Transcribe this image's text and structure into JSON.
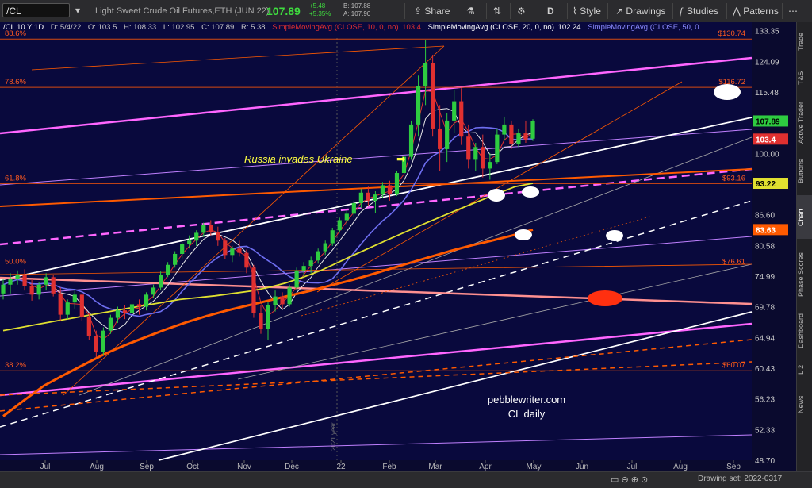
{
  "toolbar": {
    "symbol": "/CL",
    "description": "Light Sweet Crude Oil Futures,ETH (JUN 22)",
    "last": "107.89",
    "change": "+5.48",
    "change_pct": "+5.35%",
    "bid": "B: 107.88",
    "ask": "A: 107.90",
    "share_label": "Share",
    "period_label": "D",
    "style_label": "Style",
    "drawings_label": "Drawings",
    "studies_label": "Studies",
    "patterns_label": "Patterns"
  },
  "legend": {
    "header": "/CL 10 Y 1D",
    "date": "D: 5/4/22",
    "open": "O: 103.5",
    "high": "H: 108.33",
    "low": "L: 102.95",
    "close": "C: 107.89",
    "range": "R: 5.38",
    "sma10": "SimpleMovingAvg (CLOSE, 10, 0, no)",
    "sma10_val": "103.4",
    "sma20": "SimpleMovingAvg (CLOSE, 20, 0, no)",
    "sma20_val": "102.24",
    "sma50": "SimpleMovingAvg (CLOSE, 50, 0..."
  },
  "sidebar": {
    "tabs": [
      "Trade",
      "T&S",
      "Active Trader",
      "Buttons",
      "Chart",
      "Phase Scores",
      "Dashboard",
      "L 2",
      "News"
    ]
  },
  "status": {
    "drawing_set": "Drawing set: 2022-0317"
  },
  "colors": {
    "background": "#09093d",
    "up_candle": "#2ecc40",
    "down_candle": "#e03030",
    "sma10": "#e03030",
    "sma20": "#e8e8e8",
    "sma50": "#6e6ef0",
    "sma100": "#e0e030",
    "sma200": "#ff5a00",
    "magenta": "#ff66ff",
    "fib": "#ff5a00"
  },
  "chart_data": {
    "type": "candlestick",
    "title": "Russia invades Ukraine",
    "watermark": [
      "pebblewriter.com",
      "CL daily"
    ],
    "year_marker": "2021 year",
    "x_categories": [
      "Jul",
      "Aug",
      "Sep",
      "Oct",
      "Nov",
      "Dec",
      "22",
      "Feb",
      "Mar",
      "Apr",
      "May",
      "Jun",
      "Jul",
      "Aug",
      "Sep"
    ],
    "y_ticks": [
      133.35,
      124.09,
      115.48,
      107.89,
      100,
      93.22,
      86.6,
      80.58,
      74.99,
      69.78,
      64.94,
      60.43,
      56.23,
      52.33,
      48.7
    ],
    "y_scale": "log",
    "ylim": [
      48.7,
      136
    ],
    "price_labels": [
      {
        "text": "107.89",
        "value": 107.89,
        "color": "#2ecc40"
      },
      {
        "text": "103.4",
        "value": 103.4,
        "color": "#e03030"
      },
      {
        "text": "93.22",
        "value": 93.22,
        "color": "#e0e030"
      },
      {
        "text": "83.63",
        "value": 83.63,
        "color": "#ff5a00"
      }
    ],
    "fib_levels": [
      {
        "pct": "88.6%",
        "price": "$130.74",
        "value": 130.74
      },
      {
        "pct": "78.6%",
        "price": "$116.72",
        "value": 116.72
      },
      {
        "pct": "61.8%",
        "price": "$93.16",
        "value": 93.16
      },
      {
        "pct": "50.0%",
        "price": "$76.61",
        "value": 76.61
      },
      {
        "pct": "38.2%",
        "price": "$60.07",
        "value": 60.07
      }
    ],
    "candles": [
      {
        "o": 72,
        "h": 74.5,
        "l": 71,
        "c": 73.5
      },
      {
        "o": 73.5,
        "h": 75.5,
        "l": 72,
        "c": 74.5
      },
      {
        "o": 74.5,
        "h": 76,
        "l": 73.5,
        "c": 75.2
      },
      {
        "o": 75.2,
        "h": 76.2,
        "l": 72.5,
        "c": 73.2
      },
      {
        "o": 73.2,
        "h": 74.5,
        "l": 70.8,
        "c": 71.8
      },
      {
        "o": 71.8,
        "h": 74,
        "l": 71,
        "c": 73.5
      },
      {
        "o": 73.5,
        "h": 75.5,
        "l": 72.5,
        "c": 74.8
      },
      {
        "o": 74.8,
        "h": 75.2,
        "l": 71.5,
        "c": 72
      },
      {
        "o": 72,
        "h": 73,
        "l": 67.5,
        "c": 68.5
      },
      {
        "o": 68.5,
        "h": 71,
        "l": 67.8,
        "c": 70.5
      },
      {
        "o": 70.5,
        "h": 72.5,
        "l": 69.5,
        "c": 71.8
      },
      {
        "o": 71.8,
        "h": 72,
        "l": 67.5,
        "c": 68.2
      },
      {
        "o": 68.2,
        "h": 68.8,
        "l": 64.5,
        "c": 65.2
      },
      {
        "o": 65.2,
        "h": 66,
        "l": 62,
        "c": 62.8
      },
      {
        "o": 62.8,
        "h": 66.5,
        "l": 62.3,
        "c": 66
      },
      {
        "o": 66,
        "h": 68.5,
        "l": 65.5,
        "c": 68
      },
      {
        "o": 68,
        "h": 69.8,
        "l": 67.2,
        "c": 69.2
      },
      {
        "o": 69.2,
        "h": 70,
        "l": 67.8,
        "c": 68.8
      },
      {
        "o": 68.8,
        "h": 70.5,
        "l": 68.2,
        "c": 70.2
      },
      {
        "o": 70.2,
        "h": 71,
        "l": 68.5,
        "c": 69.8
      },
      {
        "o": 69.8,
        "h": 72.2,
        "l": 69.2,
        "c": 71.8
      },
      {
        "o": 71.8,
        "h": 73.5,
        "l": 71.2,
        "c": 73
      },
      {
        "o": 73,
        "h": 75.8,
        "l": 72.5,
        "c": 75.2
      },
      {
        "o": 75.2,
        "h": 77.5,
        "l": 74.8,
        "c": 77
      },
      {
        "o": 77,
        "h": 79.5,
        "l": 76.5,
        "c": 79
      },
      {
        "o": 79,
        "h": 81.2,
        "l": 78.2,
        "c": 80.8
      },
      {
        "o": 80.8,
        "h": 82.5,
        "l": 80,
        "c": 81.5
      },
      {
        "o": 81.5,
        "h": 83.5,
        "l": 80.5,
        "c": 83
      },
      {
        "o": 83,
        "h": 85,
        "l": 82.2,
        "c": 84.5
      },
      {
        "o": 84.5,
        "h": 85.5,
        "l": 82.5,
        "c": 83.2
      },
      {
        "o": 83.2,
        "h": 84.2,
        "l": 80.5,
        "c": 81.5
      },
      {
        "o": 81.5,
        "h": 82,
        "l": 78,
        "c": 78.8
      },
      {
        "o": 78.8,
        "h": 80.5,
        "l": 77.5,
        "c": 80
      },
      {
        "o": 80,
        "h": 81.5,
        "l": 78.5,
        "c": 79.2
      },
      {
        "o": 79.2,
        "h": 79.8,
        "l": 75.5,
        "c": 76.5
      },
      {
        "o": 76.5,
        "h": 77,
        "l": 68,
        "c": 68.8
      },
      {
        "o": 68.8,
        "h": 70,
        "l": 65.5,
        "c": 66.2
      },
      {
        "o": 66.2,
        "h": 70.5,
        "l": 64.5,
        "c": 70
      },
      {
        "o": 70,
        "h": 72.5,
        "l": 69,
        "c": 71.5
      },
      {
        "o": 71.5,
        "h": 72.2,
        "l": 69.5,
        "c": 70.2
      },
      {
        "o": 70.2,
        "h": 73.5,
        "l": 69.8,
        "c": 73
      },
      {
        "o": 73,
        "h": 76.5,
        "l": 72.5,
        "c": 76
      },
      {
        "o": 76,
        "h": 77.5,
        "l": 74.8,
        "c": 76.8
      },
      {
        "o": 76.8,
        "h": 78.5,
        "l": 75.5,
        "c": 77.8
      },
      {
        "o": 77.8,
        "h": 80,
        "l": 77.2,
        "c": 79.5
      },
      {
        "o": 79.5,
        "h": 81.5,
        "l": 78.8,
        "c": 81
      },
      {
        "o": 81,
        "h": 84,
        "l": 80.5,
        "c": 83.5
      },
      {
        "o": 83.5,
        "h": 86,
        "l": 83,
        "c": 85.5
      },
      {
        "o": 85.5,
        "h": 87.5,
        "l": 84.5,
        "c": 86.8
      },
      {
        "o": 86.8,
        "h": 89.5,
        "l": 86.2,
        "c": 89
      },
      {
        "o": 89,
        "h": 92,
        "l": 88,
        "c": 91.2
      },
      {
        "o": 91.2,
        "h": 92.5,
        "l": 88.5,
        "c": 89.5
      },
      {
        "o": 89.5,
        "h": 91.5,
        "l": 87,
        "c": 90.8
      },
      {
        "o": 90.8,
        "h": 93.5,
        "l": 90,
        "c": 92.8
      },
      {
        "o": 92.8,
        "h": 93.8,
        "l": 89.5,
        "c": 91
      },
      {
        "o": 91,
        "h": 96,
        "l": 90.5,
        "c": 95.5
      },
      {
        "o": 95.5,
        "h": 100,
        "l": 94.5,
        "c": 99.2
      },
      {
        "o": 99.2,
        "h": 108,
        "l": 98.5,
        "c": 107
      },
      {
        "o": 107,
        "h": 120,
        "l": 104,
        "c": 117
      },
      {
        "o": 117,
        "h": 130.5,
        "l": 112,
        "c": 123.5
      },
      {
        "o": 123.5,
        "h": 126,
        "l": 104,
        "c": 106
      },
      {
        "o": 106,
        "h": 112,
        "l": 96,
        "c": 101
      },
      {
        "o": 101,
        "h": 110,
        "l": 98,
        "c": 108
      },
      {
        "o": 108,
        "h": 116,
        "l": 105,
        "c": 113
      },
      {
        "o": 113,
        "h": 116.5,
        "l": 102,
        "c": 104
      },
      {
        "o": 104,
        "h": 107,
        "l": 96.5,
        "c": 98.5
      },
      {
        "o": 98.5,
        "h": 102.5,
        "l": 96,
        "c": 101.5
      },
      {
        "o": 101.5,
        "h": 104.5,
        "l": 94.5,
        "c": 96.5
      },
      {
        "o": 96.5,
        "h": 100,
        "l": 94,
        "c": 98
      },
      {
        "o": 98,
        "h": 106,
        "l": 97.5,
        "c": 104.5
      },
      {
        "o": 104.5,
        "h": 109,
        "l": 103,
        "c": 107
      },
      {
        "o": 107,
        "h": 108,
        "l": 101,
        "c": 102.2
      },
      {
        "o": 102.2,
        "h": 106,
        "l": 101.5,
        "c": 104.8
      },
      {
        "o": 104.8,
        "h": 108,
        "l": 102.5,
        "c": 103.3
      },
      {
        "o": 103.5,
        "h": 108.33,
        "l": 102.95,
        "c": 107.89
      }
    ],
    "moving_averages": [
      {
        "name": "SMA 10",
        "period": 10,
        "color": "#e03030"
      },
      {
        "name": "SMA 20",
        "period": 20,
        "color": "#e8e8e8"
      },
      {
        "name": "SMA 50",
        "period": 50,
        "color": "#6e6ef0"
      },
      {
        "name": "SMA 100",
        "period": 100,
        "color": "#e0e030",
        "values": [
          66,
          66.5,
          67,
          67.5,
          68,
          68.5,
          69,
          69.5,
          70,
          70.5,
          71,
          71.3,
          71.6,
          72,
          72.4,
          73,
          73.8,
          74.8,
          76,
          77.5,
          79,
          80.5,
          82,
          83.5,
          85,
          86.5,
          88,
          89.5,
          91,
          92.5,
          93.22
        ]
      },
      {
        "name": "SMA 200",
        "period": 200,
        "color": "#ff5a00",
        "values": [
          54,
          56,
          58,
          59.5,
          61,
          62.5,
          63.8,
          65,
          66.2,
          67.3,
          68.3,
          69.2,
          70,
          70.8,
          71.6,
          72.4,
          73.3,
          74.2,
          75.2,
          76.3,
          77.4,
          78.5,
          79.6,
          80.6,
          81.5,
          82.5,
          83.63
        ]
      }
    ]
  }
}
